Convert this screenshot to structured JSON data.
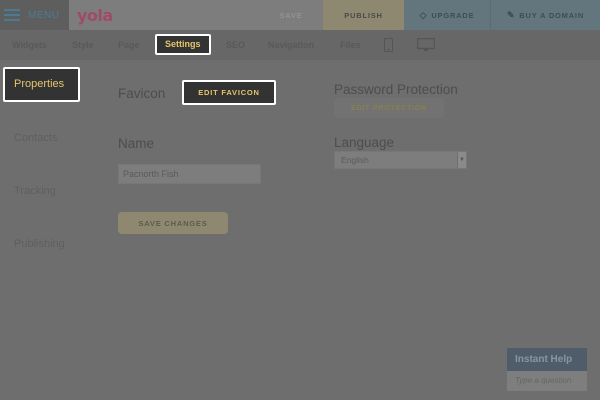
{
  "topbar": {
    "menu_label": "MENU",
    "logo": "yola",
    "save_label": "SAVE",
    "publish_label": "PUBLISH",
    "upgrade_label": "UPGRADE",
    "domain_label": "BUY A DOMAIN"
  },
  "subnav": {
    "items": [
      "Widgets",
      "Style",
      "Page",
      "Settings",
      "SEO",
      "Navigation",
      "Files"
    ],
    "active": "Settings"
  },
  "leftnav": {
    "items": [
      "Properties",
      "Contacts",
      "Tracking",
      "Publishing"
    ],
    "active": "Properties"
  },
  "content": {
    "favicon_label": "Favicon",
    "edit_favicon_label": "EDIT FAVICON",
    "name_label": "Name",
    "name_value": "Pacnorth Fish",
    "save_changes_label": "SAVE CHANGES",
    "password_label": "Password Protection",
    "edit_protection_label": "EDIT PROTECTION",
    "language_label": "Language",
    "language_value": "English"
  },
  "help": {
    "title": "Instant Help",
    "placeholder": "Type a question"
  },
  "colors": {
    "overlay": "#6e6e6e",
    "highlight_bg": "#333333",
    "highlight_text": "#e6c66b",
    "highlight_border": "#ffffff"
  }
}
